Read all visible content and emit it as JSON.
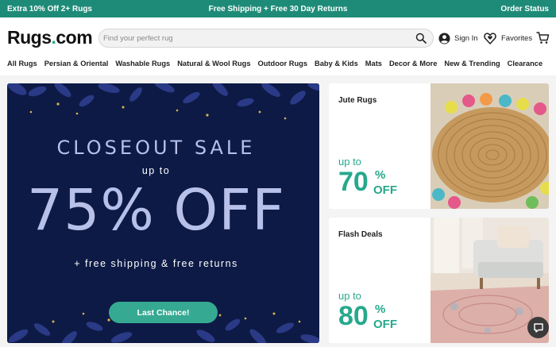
{
  "promo_bar": {
    "left": "Extra 10% Off 2+ Rugs",
    "center": "Free Shipping + Free 30 Day Returns",
    "right": "Order Status"
  },
  "header": {
    "logo_main": "Rugs",
    "logo_dot": ".",
    "logo_tld": "com",
    "search_placeholder": "Find your perfect rug",
    "sign_in": "Sign In",
    "favorites": "Favorites"
  },
  "nav": {
    "items": [
      "All Rugs",
      "Persian & Oriental",
      "Washable Rugs",
      "Natural & Wool Rugs",
      "Outdoor Rugs",
      "Baby & Kids",
      "Mats",
      "Decor & More",
      "New & Trending",
      "Clearance"
    ]
  },
  "hero": {
    "title": "CLOSEOUT SALE",
    "up_to": "up to",
    "discount": "75% OFF",
    "subtitle": "+ free shipping & free returns",
    "button": "Last Chance!"
  },
  "cards": [
    {
      "title": "Jute Rugs",
      "up_to": "up to",
      "value": "70",
      "pct": "%",
      "off": "OFF"
    },
    {
      "title": "Flash Deals",
      "up_to": "up to",
      "value": "80",
      "pct": "%",
      "off": "OFF"
    }
  ],
  "colors": {
    "brand_teal": "#1e8b78",
    "accent_teal": "#27a88d",
    "hero_navy": "#0d1a45",
    "hero_text": "#b7c0e8"
  }
}
